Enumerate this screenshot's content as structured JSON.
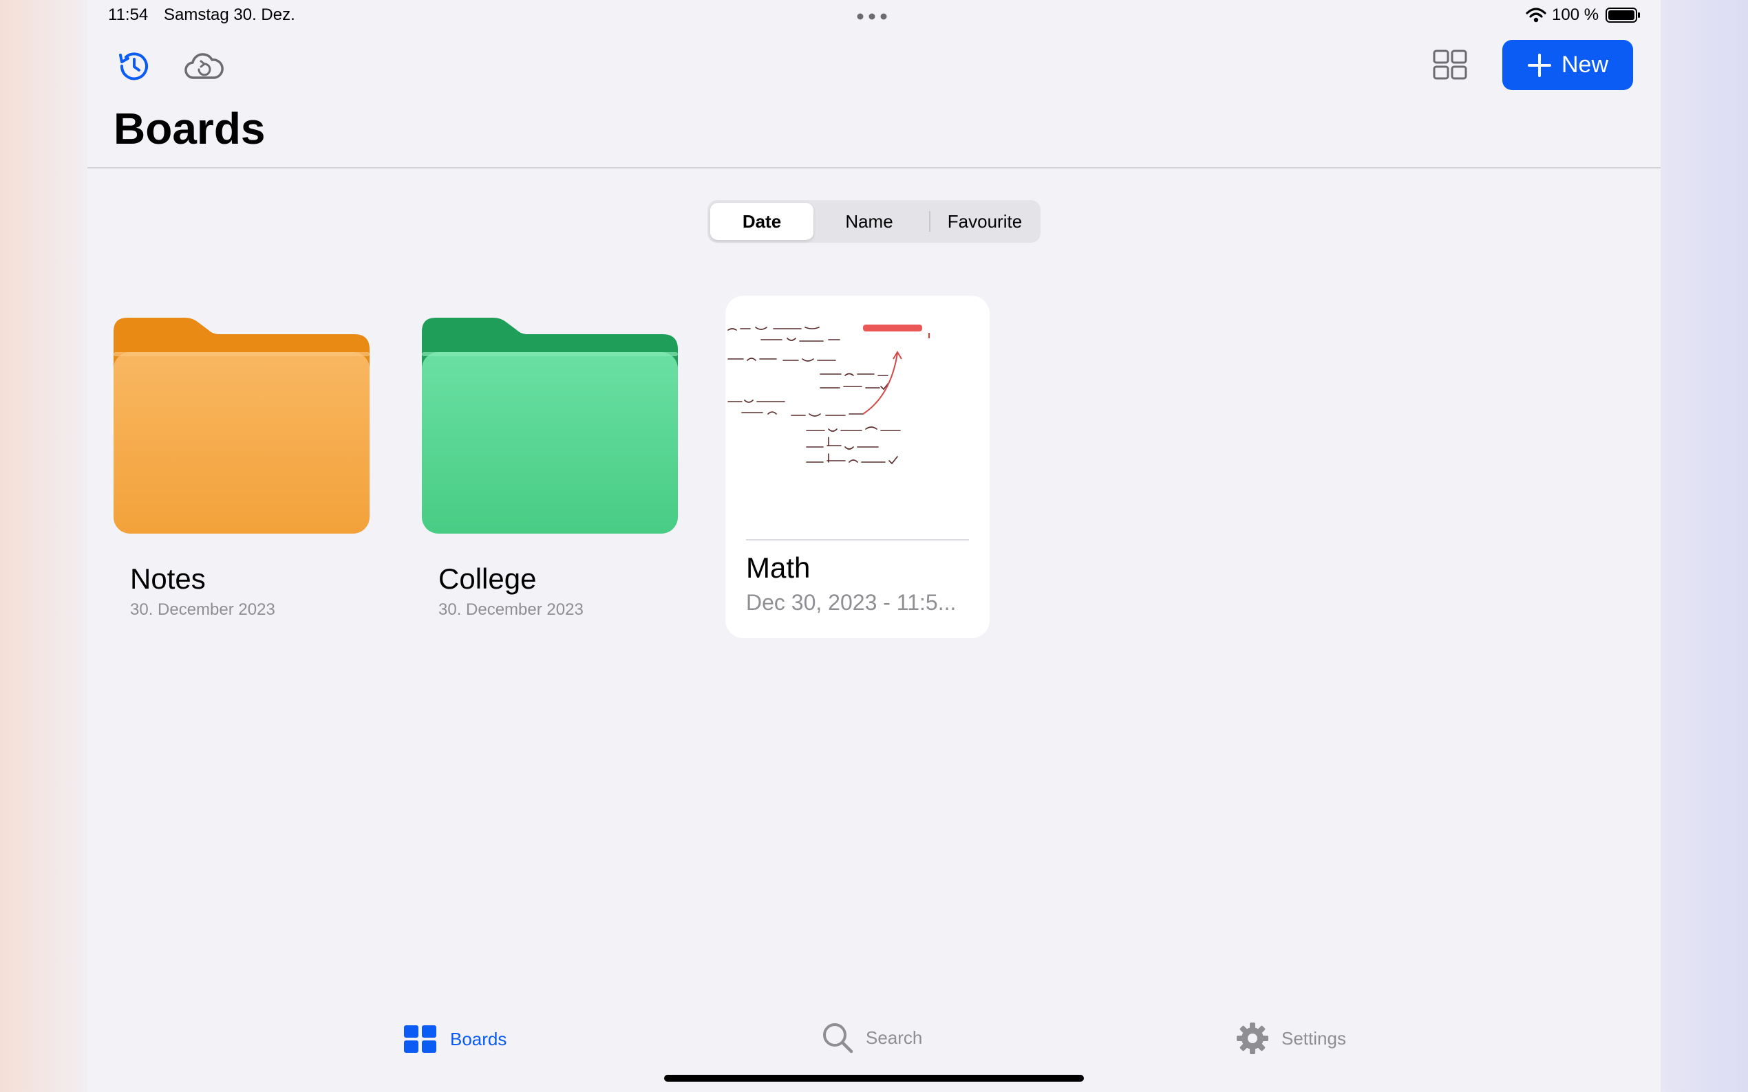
{
  "status_bar": {
    "time": "11:54",
    "date": "Samstag 30. Dez.",
    "battery_percent": "100 %",
    "battery_level": 1.0
  },
  "toolbar": {
    "history_icon": "history-clock-icon",
    "cloud_icon": "cloud-sync-icon",
    "grid_icon": "grid-view-icon",
    "new_label": "New",
    "accent_color": "#0a5cf5"
  },
  "page": {
    "title": "Boards"
  },
  "sort": {
    "options": [
      "Date",
      "Name",
      "Favourite"
    ],
    "selected": "Date"
  },
  "items": [
    {
      "type": "folder",
      "name": "Notes",
      "date": "30. December 2023",
      "color": "#f7a942"
    },
    {
      "type": "folder",
      "name": "College",
      "date": "30. December 2023",
      "color": "#4fd18e"
    },
    {
      "type": "board",
      "name": "Math",
      "date": "Dec 30, 2023 - 11:5..."
    }
  ],
  "tabs": [
    {
      "label": "Boards",
      "icon": "boards-grid-icon",
      "active": true
    },
    {
      "label": "Search",
      "icon": "magnifier-icon",
      "active": false
    },
    {
      "label": "Settings",
      "icon": "gear-icon",
      "active": false
    }
  ]
}
